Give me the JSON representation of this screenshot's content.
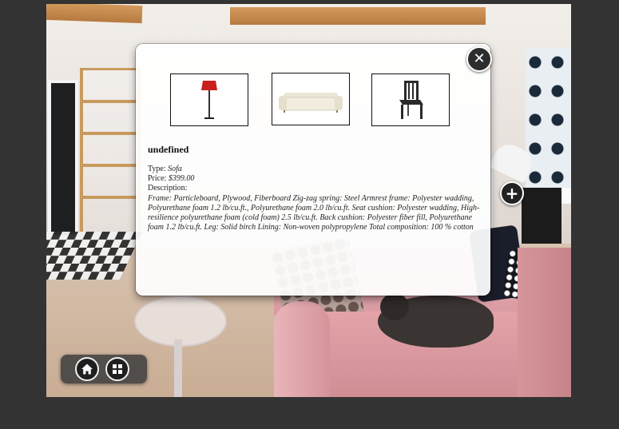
{
  "dialog": {
    "title": "undefined",
    "thumbnails": [
      {
        "icon": "floor-lamp-icon"
      },
      {
        "icon": "sofa-icon"
      },
      {
        "icon": "chair-icon"
      }
    ],
    "type_label": "Type:",
    "type_value": "Sofa",
    "price_label": "Price:",
    "price_value": "$399.00",
    "description_label": "Description:",
    "description_text": "Frame: Particleboard, Plywood, Fiberboard Zig-zag spring: Steel Armrest frame: Polyester wadding, Polyurethane foam 1.2 lb/cu.ft., Polyurethane foam 2.0 lb/cu.ft. Seat cushion: Polyester wadding, High-resilience polyurethane foam (cold foam) 2.5 lb/cu.ft. Back cushion: Polyester fiber fill, Polyurethane foam 1.2 lb/cu.ft. Leg: Solid birch Lining: Non-woven polypropylene Total composition: 100 % cotton",
    "close_icon": "close-icon"
  },
  "overlay": {
    "plus_icon": "plus-icon"
  },
  "toolbar": {
    "home_icon": "home-icon",
    "grid_icon": "grid-icon"
  },
  "colors": {
    "background": "#333333",
    "dialog_bg": "#ffffff",
    "button_dark": "#222222"
  }
}
